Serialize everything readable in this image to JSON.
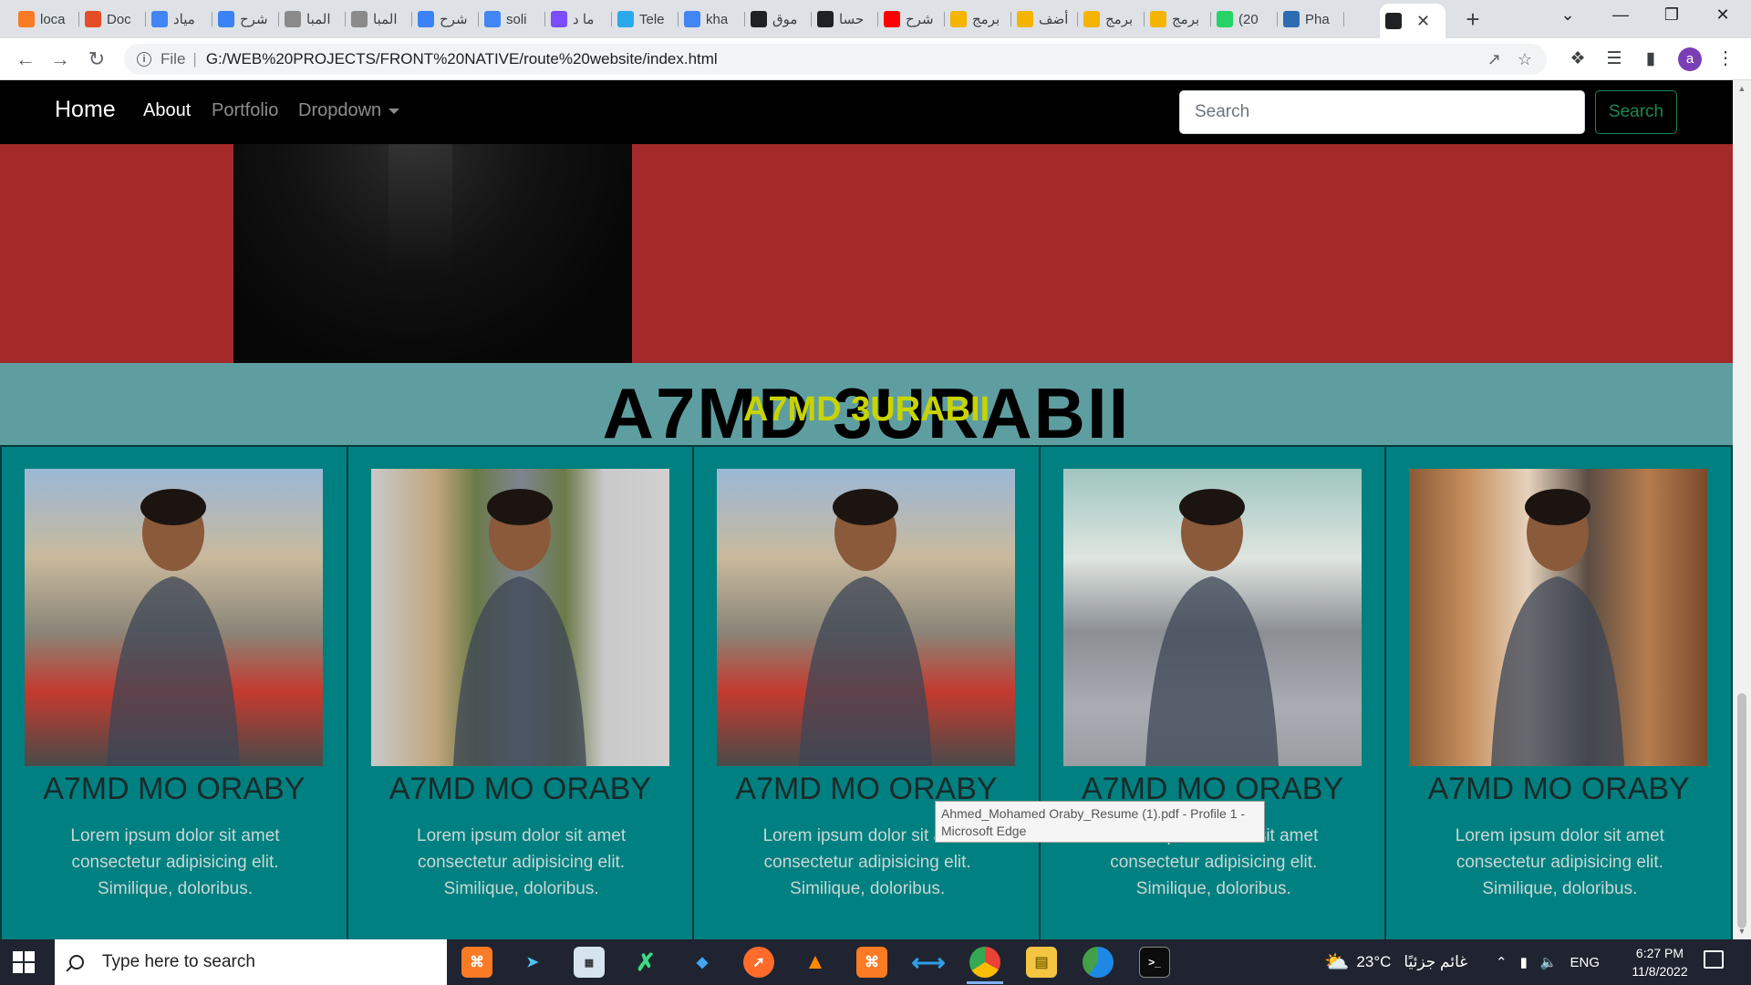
{
  "browser": {
    "tabs": [
      {
        "label": "loca",
        "icon": "xampp-icon",
        "color": "#fb7a24"
      },
      {
        "label": "Doc",
        "icon": "html5-icon",
        "color": "#e44d26"
      },
      {
        "label": "مياد",
        "icon": "google-icon",
        "color": "#4285f4"
      },
      {
        "label": "شرح",
        "icon": "drop-icon",
        "color": "#3b82f6"
      },
      {
        "label": "المبا",
        "icon": "page-icon",
        "color": "#8a8a8a"
      },
      {
        "label": "المبا",
        "icon": "page-icon",
        "color": "#8a8a8a"
      },
      {
        "label": "شرح",
        "icon": "drop-icon",
        "color": "#3b82f6"
      },
      {
        "label": "soli",
        "icon": "google-icon",
        "color": "#4285f4"
      },
      {
        "label": "ما د",
        "icon": "u-icon",
        "color": "#7c4dff"
      },
      {
        "label": "Tele",
        "icon": "telegram-icon",
        "color": "#29a9eb"
      },
      {
        "label": "kha",
        "icon": "google-icon",
        "color": "#4285f4"
      },
      {
        "label": "موق",
        "icon": "globe-icon",
        "color": "#202124"
      },
      {
        "label": "حسا",
        "icon": "mastodon-icon",
        "color": "#202124"
      },
      {
        "label": "شرح",
        "icon": "youtube-icon",
        "color": "#ff0000"
      },
      {
        "label": "برمج",
        "icon": "five-icon",
        "color": "#f4b400"
      },
      {
        "label": "أضف",
        "icon": "five-icon",
        "color": "#f4b400"
      },
      {
        "label": "برمج",
        "icon": "five-icon",
        "color": "#f4b400"
      },
      {
        "label": "برمج",
        "icon": "five-icon",
        "color": "#f4b400"
      },
      {
        "label": "(20",
        "icon": "whatsapp-icon",
        "color": "#25d366"
      },
      {
        "label": "Pha",
        "icon": "app-icon",
        "color": "#2b6cb0"
      },
      {
        "label": "",
        "icon": "lens-icon",
        "color": "#202124",
        "active": true
      }
    ],
    "url_scheme": "File",
    "url": "G:/WEB%20PROJECTS/FRONT%20NATIVE/route%20website/index.html",
    "profile_initial": "a"
  },
  "site": {
    "brand": "Home",
    "nav": [
      {
        "label": "About",
        "active": true
      },
      {
        "label": "Portfolio",
        "active": false
      },
      {
        "label": "Dropdown",
        "active": false
      }
    ],
    "search_placeholder": "Search",
    "search_button": "Search",
    "headline": "A7MD 3URABII",
    "headline_overlay": "A7MD 3URABII",
    "headline_overlay_color": "#c8d400",
    "hero_color": "#a42a2a",
    "cards": [
      {
        "name": "A7MD MO ORABY",
        "text": "Lorem ipsum dolor sit amet consectetur adipisicing elit. Similique, doloribus."
      },
      {
        "name": "A7MD MO ORABY",
        "text": "Lorem ipsum dolor sit amet consectetur adipisicing elit. Similique, doloribus."
      },
      {
        "name": "A7MD MO ORABY",
        "text": "Lorem ipsum dolor sit amet consectetur adipisicing elit. Similique, doloribus."
      },
      {
        "name": "A7MD MO ORABY",
        "text": "Lorem ipsum dolor sit amet consectetur adipisicing elit. Similique, doloribus."
      },
      {
        "name": "A7MD MO ORABY",
        "text": "Lorem ipsum dolor sit amet consectetur adipisicing elit. Similique, doloribus."
      }
    ],
    "tooltip": "Ahmed_Mohamed Oraby_Resume (1).pdf - Profile 1 - Microsoft Edge"
  },
  "taskbar": {
    "search_placeholder": "Type here to search",
    "weather_temp": "23°C",
    "weather_text": "غائم جزئيًا",
    "language": "ENG",
    "time": "6:27 PM",
    "date": "11/8/2022"
  }
}
